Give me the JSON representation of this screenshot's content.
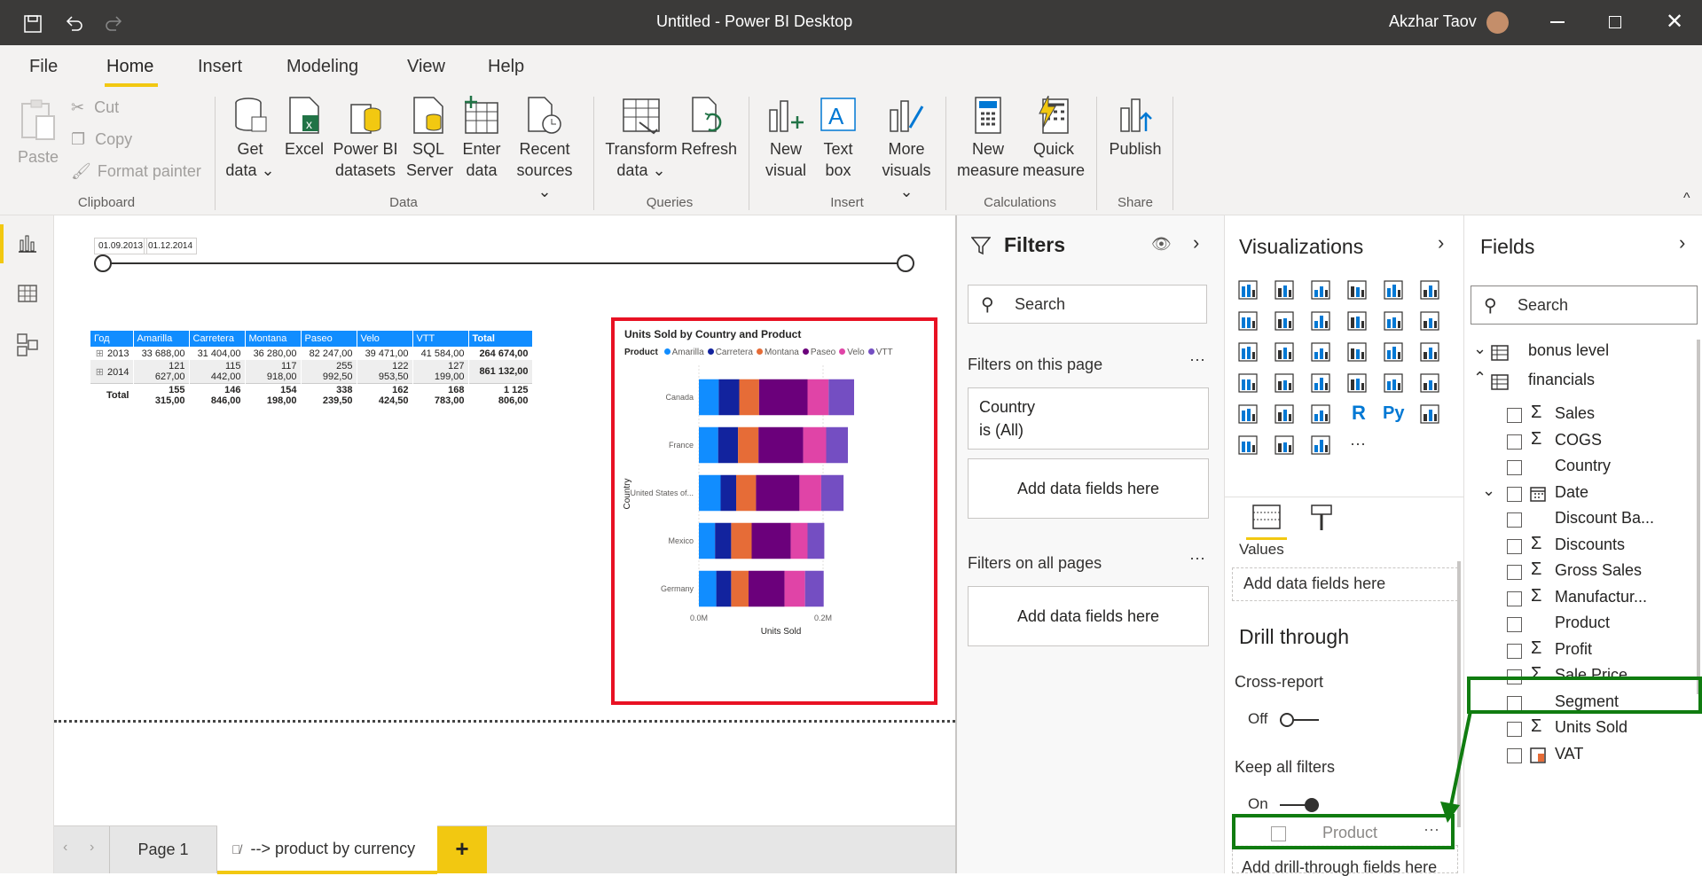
{
  "titlebar": {
    "title": "Untitled - Power BI Desktop",
    "user": "Akzhar Taov"
  },
  "tabs": [
    "File",
    "Home",
    "Insert",
    "Modeling",
    "View",
    "Help"
  ],
  "clipboard": {
    "paste": "Paste",
    "cut": "Cut",
    "copy": "Copy",
    "format_painter": "Format painter",
    "group": "Clipboard"
  },
  "data_group": {
    "get_data_1": "Get",
    "get_data_2": "data",
    "excel": "Excel",
    "pbi_1": "Power BI",
    "pbi_2": "datasets",
    "sql_1": "SQL",
    "sql_2": "Server",
    "enter_1": "Enter",
    "enter_2": "data",
    "recent_1": "Recent",
    "recent_2": "sources",
    "group": "Data"
  },
  "queries_group": {
    "transform_1": "Transform",
    "transform_2": "data",
    "refresh": "Refresh",
    "group": "Queries"
  },
  "insert_group": {
    "newvis_1": "New",
    "newvis_2": "visual",
    "text_1": "Text",
    "text_2": "box",
    "more_1": "More",
    "more_2": "visuals",
    "group": "Insert"
  },
  "calc_group": {
    "newm_1": "New",
    "newm_2": "measure",
    "quick_1": "Quick",
    "quick_2": "measure",
    "group": "Calculations"
  },
  "share_group": {
    "publish": "Publish",
    "group": "Share"
  },
  "slicer": {
    "start": "01.09.2013",
    "end": "01.12.2014"
  },
  "matrix": {
    "headers": [
      "Год",
      "Amarilla",
      "Carretera",
      "Montana",
      "Paseo",
      "Velo",
      "VTT",
      "Total"
    ],
    "rows": [
      [
        "2013",
        "33 688,00",
        "31 404,00",
        "36 280,00",
        "82 247,00",
        "39 471,00",
        "41 584,00",
        "264 674,00"
      ],
      [
        "2014",
        "121 627,00",
        "115 442,00",
        "117 918,00",
        "255 992,50",
        "122 953,50",
        "127 199,00",
        "861 132,00"
      ],
      [
        "Total",
        "155 315,00",
        "146 846,00",
        "154 198,00",
        "338 239,50",
        "162 424,50",
        "168 783,00",
        "1 125 806,00"
      ]
    ]
  },
  "chart_data": {
    "type": "bar",
    "title": "Units Sold by Country and Product",
    "legend_title": "Product",
    "xlabel": "Units Sold",
    "ylabel": "Country",
    "x_ticks": [
      "0.0M",
      "0.2M"
    ],
    "xlim": [
      0,
      0.25
    ],
    "categories": [
      "Canada",
      "France",
      "United States of...",
      "Mexico",
      "Germany"
    ],
    "series": [
      {
        "name": "Amarilla",
        "color": "#118dff",
        "values": [
          0.032,
          0.031,
          0.035,
          0.026,
          0.028
        ]
      },
      {
        "name": "Carretera",
        "color": "#12239e",
        "values": [
          0.033,
          0.032,
          0.025,
          0.026,
          0.024
        ]
      },
      {
        "name": "Montana",
        "color": "#e66c37",
        "values": [
          0.032,
          0.033,
          0.032,
          0.033,
          0.028
        ]
      },
      {
        "name": "Paseo",
        "color": "#6b007b",
        "values": [
          0.078,
          0.072,
          0.07,
          0.063,
          0.058
        ]
      },
      {
        "name": "Velo",
        "color": "#e044a7",
        "values": [
          0.034,
          0.037,
          0.035,
          0.027,
          0.033
        ]
      },
      {
        "name": "VTT",
        "color": "#744ec2",
        "values": [
          0.041,
          0.035,
          0.036,
          0.027,
          0.03
        ]
      }
    ]
  },
  "filters": {
    "title": "Filters",
    "search": "Search",
    "on_page": "Filters on this page",
    "country_1": "Country",
    "country_2": "is (All)",
    "add": "Add data fields here",
    "on_all": "Filters on all pages",
    "add2": "Add data fields here"
  },
  "viz": {
    "title": "Visualizations",
    "values": "Values",
    "add_values": "Add data fields here",
    "drill": "Drill through",
    "cross": "Cross-report",
    "off": "Off",
    "keep": "Keep all filters",
    "on": "On",
    "drag_field": "Product",
    "add_drill": "Add drill-through fields here"
  },
  "fields": {
    "title": "Fields",
    "search": "Search",
    "tables": [
      "bonus level",
      "financials"
    ],
    "items": [
      {
        "name": "Sales",
        "sigma": true
      },
      {
        "name": "COGS",
        "sigma": true
      },
      {
        "name": "Country",
        "sigma": false
      },
      {
        "name": "Date",
        "sigma": false
      },
      {
        "name": "Discount Ba...",
        "sigma": false
      },
      {
        "name": "Discounts",
        "sigma": true
      },
      {
        "name": "Gross Sales",
        "sigma": true
      },
      {
        "name": "Manufactur...",
        "sigma": true
      },
      {
        "name": "Product",
        "sigma": false
      },
      {
        "name": "Profit",
        "sigma": true
      },
      {
        "name": "Sale Price",
        "sigma": true
      },
      {
        "name": "Segment",
        "sigma": false
      },
      {
        "name": "Units Sold",
        "sigma": true
      },
      {
        "name": "VAT",
        "sigma": false
      }
    ]
  },
  "pages": {
    "page1": "Page 1",
    "page2": "--> product by currency",
    "add": "+"
  }
}
